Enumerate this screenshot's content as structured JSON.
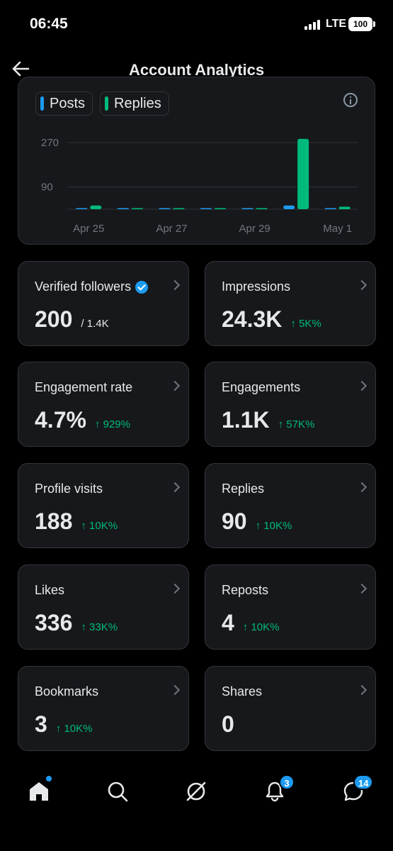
{
  "status": {
    "time": "06:45",
    "network": "LTE",
    "battery": "100"
  },
  "header": {
    "title": "Account Analytics",
    "back_icon": "arrow-left-icon"
  },
  "chart_data": {
    "type": "bar",
    "series": [
      {
        "name": "Posts",
        "color": "#1d9bf0",
        "x": [
          "Apr 25",
          "Apr 26",
          "Apr 27",
          "Apr 28",
          "Apr 29",
          "Apr 30",
          "May 1"
        ],
        "values": [
          0,
          2,
          2,
          0,
          0,
          15,
          2
        ]
      },
      {
        "name": "Replies",
        "color": "#00ba7c",
        "x": [
          "Apr 25",
          "Apr 26",
          "Apr 27",
          "Apr 28",
          "Apr 29",
          "Apr 30",
          "May 1"
        ],
        "values": [
          15,
          3,
          3,
          1,
          1,
          285,
          10
        ]
      }
    ],
    "x_tick_labels": [
      "Apr 25",
      "Apr 27",
      "Apr 29",
      "May 1"
    ],
    "y_tick_labels": [
      "270",
      "90"
    ],
    "y_ticks": [
      270,
      90
    ],
    "ylim": [
      0,
      300
    ],
    "title": "",
    "xlabel": "",
    "ylabel": ""
  },
  "stats": [
    {
      "label": "Verified followers",
      "value": "200",
      "sub": "/ 1.4K",
      "delta": "",
      "verified": true
    },
    {
      "label": "Impressions",
      "value": "24.3K",
      "sub": "",
      "delta": "↑ 5K%"
    },
    {
      "label": "Engagement rate",
      "value": "4.7%",
      "sub": "",
      "delta": "↑ 929%"
    },
    {
      "label": "Engagements",
      "value": "1.1K",
      "sub": "",
      "delta": "↑ 57K%"
    },
    {
      "label": "Profile visits",
      "value": "188",
      "sub": "",
      "delta": "↑ 10K%"
    },
    {
      "label": "Replies",
      "value": "90",
      "sub": "",
      "delta": "↑ 10K%"
    },
    {
      "label": "Likes",
      "value": "336",
      "sub": "",
      "delta": "↑ 33K%"
    },
    {
      "label": "Reposts",
      "value": "4",
      "sub": "",
      "delta": "↑ 10K%"
    },
    {
      "label": "Bookmarks",
      "value": "3",
      "sub": "",
      "delta": "↑ 10K%"
    },
    {
      "label": "Shares",
      "value": "0",
      "sub": "",
      "delta": ""
    }
  ],
  "nav": {
    "items": [
      "home-icon",
      "search-icon",
      "grok-icon",
      "bell-icon",
      "messages-icon"
    ],
    "notifications_badge": "3",
    "messages_badge": "14"
  },
  "colors": {
    "accent": "#1d9bf0",
    "positive": "#00ba7c",
    "background": "#000000",
    "card": "#16181c"
  }
}
